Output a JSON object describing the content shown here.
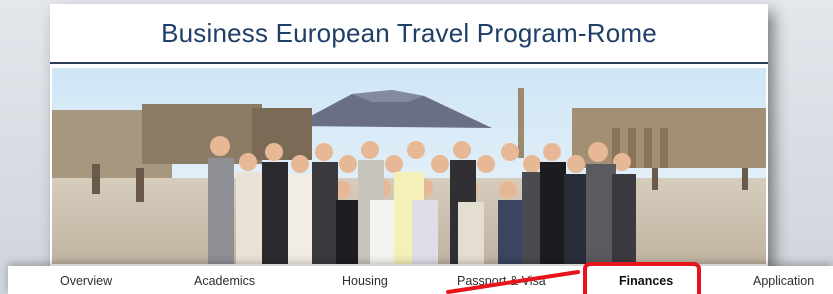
{
  "header": {
    "title": "Business European Travel Program-Rome"
  },
  "banner": {
    "image_name": "group-photo-pompeii-vesuvius"
  },
  "nav": {
    "items": [
      {
        "label": "Overview",
        "active": false
      },
      {
        "label": "Academics",
        "active": false
      },
      {
        "label": "Housing",
        "active": false
      },
      {
        "label": "Passport & Visa",
        "active": false
      },
      {
        "label": "Finances",
        "active": true
      },
      {
        "label": "Application",
        "active": false
      }
    ]
  },
  "annotation": {
    "highlight_color": "#e8141c",
    "highlighted_item": "Finances"
  },
  "colors": {
    "title": "#1f3f66",
    "accent_rule": "#2a3f5c"
  }
}
